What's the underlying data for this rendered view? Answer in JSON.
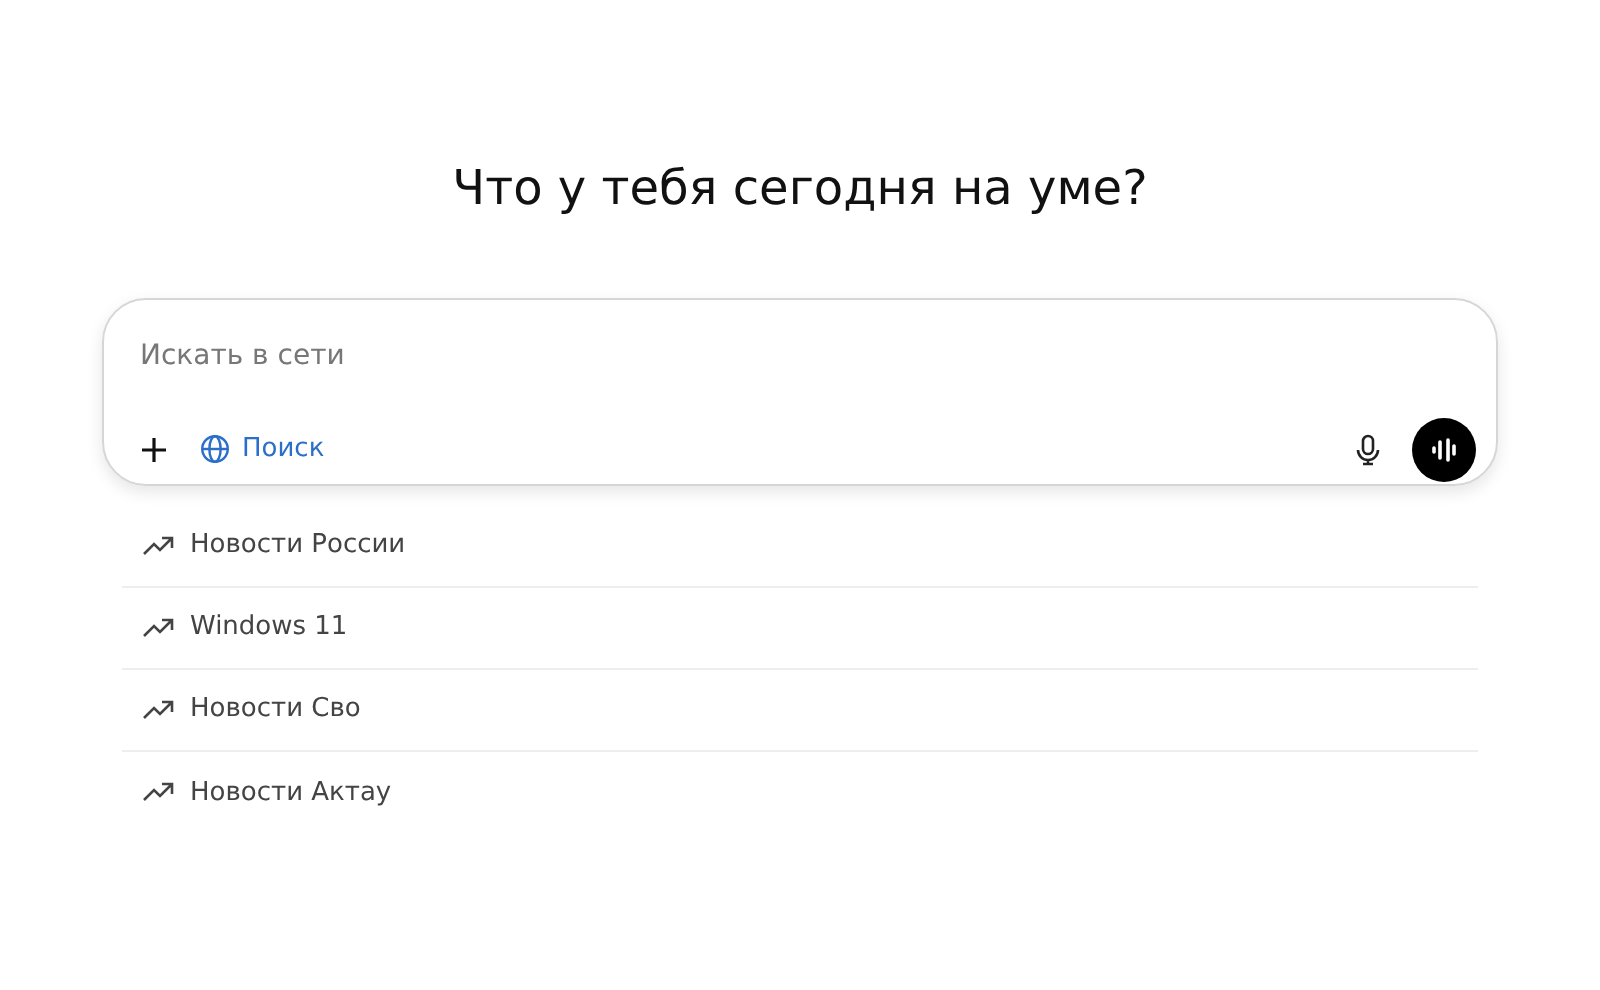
{
  "heading": "Что у тебя сегодня на уме?",
  "composer": {
    "placeholder": "Искать в сети",
    "search_label": "Поиск"
  },
  "suggestions": [
    {
      "label": "Новости России"
    },
    {
      "label": "Windows 11"
    },
    {
      "label": "Новости Сво"
    },
    {
      "label": "Новости Актау"
    }
  ]
}
